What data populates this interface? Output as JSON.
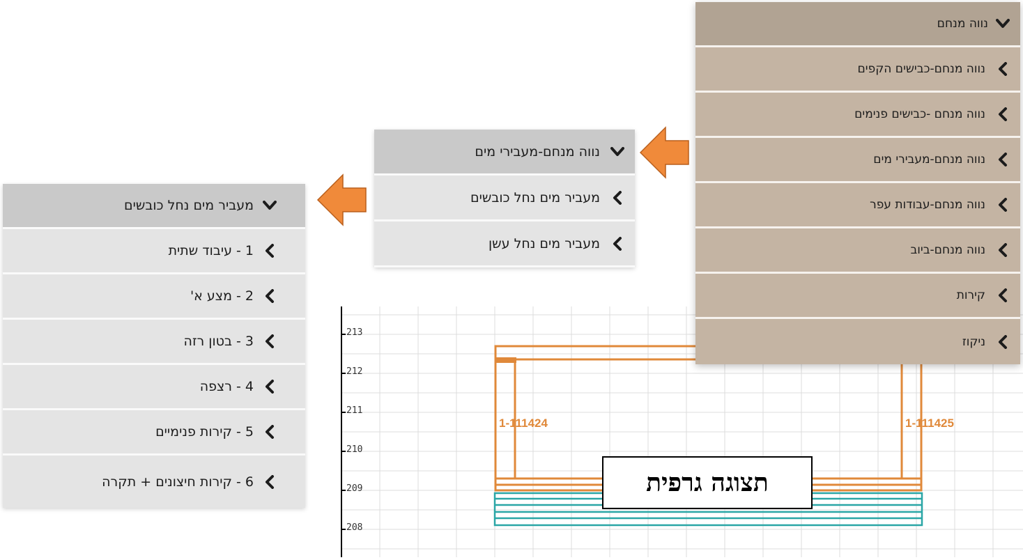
{
  "menu1": {
    "header": "נווה מנחם",
    "items": [
      "נווה מנחם-כבישים הקפים",
      "נווה מנחם -כבישים פנימים",
      "נווה מנחם-מעבירי מים",
      "נווה מנחם-עבודות עפר",
      "נווה מנחם-ביוב",
      "קירות",
      "ניקוז"
    ]
  },
  "menu2": {
    "header": "נווה מנחם-מעבירי מים",
    "items": [
      "מעביר מים נחל כובשים",
      "מעביר מים נחל עשן"
    ]
  },
  "menu3": {
    "header": "מעביר מים נחל כובשים",
    "items": [
      "1 - עיבוד שתית",
      "2 - מצע א'",
      "3 - בטון רזה",
      "4 - רצפה",
      "5 - קירות פנימיים",
      "6 - קירות חיצונים + תקרה"
    ]
  },
  "graphic": {
    "y_ticks": [
      "213",
      "212",
      "211",
      "210",
      "209",
      "208"
    ],
    "element_labels": [
      "1-111424",
      "1-111425"
    ],
    "caption": "תצוגה גרפית"
  },
  "colors": {
    "menu1_bg": "#c4b4a3",
    "menu1_header": "#b1a393",
    "menu_grey": "#e4e4e4",
    "menu_grey_header": "#c9c9c9",
    "arrow_orange": "#f08a3a",
    "element_orange": "#e0893a",
    "element_teal": "#2aa6a6"
  }
}
